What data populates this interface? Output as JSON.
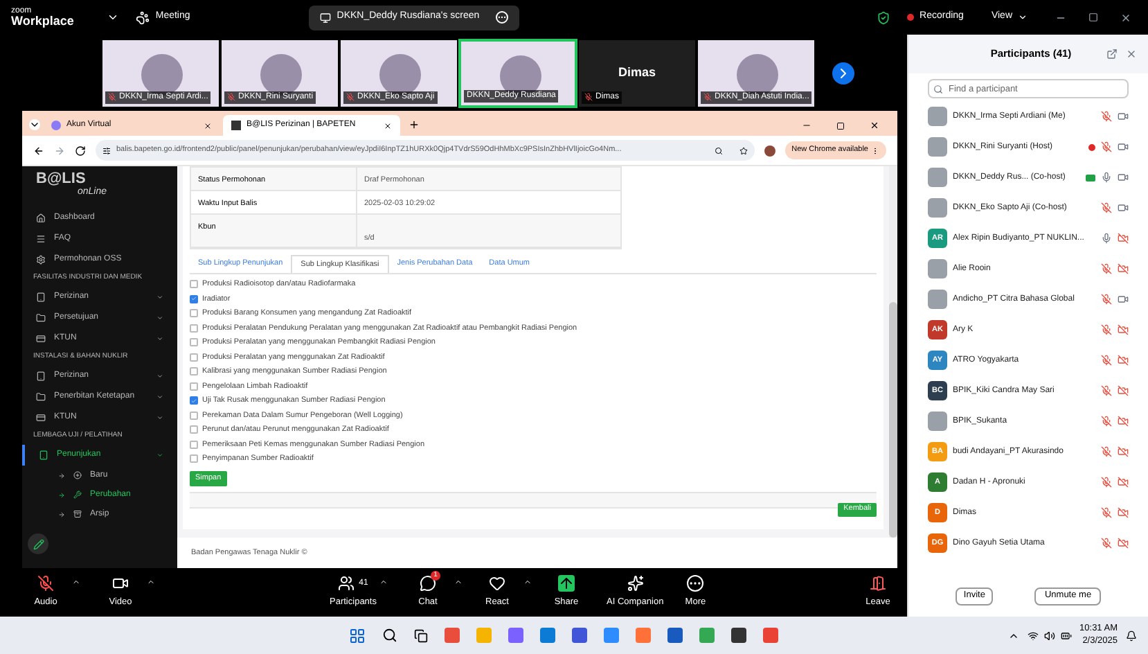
{
  "zoom_bar": {
    "brand_top": "zoom",
    "brand": "Workplace",
    "meeting": "Meeting",
    "share_pill": "DKKN_Deddy Rusdiana's screen",
    "recording": "Recording",
    "view": "View"
  },
  "video_tiles": [
    {
      "name": "DKKN_Irma Septi Ardi...",
      "muted": true,
      "speaking": false,
      "video": true
    },
    {
      "name": "DKKN_Rini Suryanti",
      "muted": true,
      "speaking": false,
      "video": true
    },
    {
      "name": "DKKN_Eko Sapto Aji",
      "muted": true,
      "speaking": false,
      "video": true
    },
    {
      "name": "DKKN_Deddy Rusdiana",
      "muted": false,
      "speaking": true,
      "video": true
    },
    {
      "name": "Dimas",
      "muted": true,
      "speaking": false,
      "video": false,
      "display_name": "Dimas"
    },
    {
      "name": "DKKN_Diah Astuti India...",
      "muted": true,
      "speaking": false,
      "video": true
    }
  ],
  "browser": {
    "tabs": [
      {
        "label": "Akun Virtual",
        "selected": false
      },
      {
        "label": "B@LIS Perizinan | BAPETEN",
        "selected": true
      }
    ],
    "url": "balis.bapeten.go.id/frontend2/public/panel/penunjukan/perubahan/view/eyJpdiI6InpTZ1hURXk0Qjp4TVdrS59OdHhMbXc9PSIsInZhbHVlIjoicGo4Nm...",
    "update_button": "New Chrome available"
  },
  "sidebar": {
    "logo": "B@LIS",
    "logo_sub": "onLine",
    "sections": [
      {
        "items": [
          {
            "label": "Dashboard",
            "expandable": false,
            "selected": false
          },
          {
            "label": "FAQ",
            "expandable": false,
            "selected": false
          },
          {
            "label": "Permohonan OSS",
            "expandable": false,
            "selected": false
          }
        ]
      },
      {
        "title": "FASILITAS INDUSTRI DAN MEDIK",
        "items": [
          {
            "label": "Perizinan",
            "expandable": true,
            "selected": false
          },
          {
            "label": "Persetujuan",
            "expandable": true,
            "selected": false
          },
          {
            "label": "KTUN",
            "expandable": true,
            "selected": false
          }
        ]
      },
      {
        "title": "INSTALASI & BAHAN NUKLIR",
        "items": [
          {
            "label": "Perizinan",
            "expandable": true,
            "selected": false
          },
          {
            "label": "Penerbitan Ketetapan",
            "expandable": true,
            "selected": false
          },
          {
            "label": "KTUN",
            "expandable": true,
            "selected": false
          }
        ]
      },
      {
        "title": "LEMBAGA UJI / PELATIHAN",
        "items": [
          {
            "label": "Penunjukan",
            "expandable": true,
            "selected": true,
            "children": [
              {
                "label": "Baru",
                "selected": false
              },
              {
                "label": "Perubahan",
                "selected": true
              },
              {
                "label": "Arsip",
                "selected": false
              }
            ]
          }
        ]
      }
    ]
  },
  "info_table": [
    {
      "label": "Status Permohonan",
      "value": "Draf Permohonan"
    },
    {
      "label": "Waktu Input Balis",
      "value": "2025-02-03 10:29:02"
    },
    {
      "label": "Kbun",
      "value": "s/d"
    }
  ],
  "tabs": [
    {
      "label": "Sub Lingkup Penunjukan",
      "selected": false
    },
    {
      "label": "Sub Lingkup Klasifikasi",
      "selected": true
    },
    {
      "label": "Jenis Perubahan Data",
      "selected": false
    },
    {
      "label": "Data Umum",
      "selected": false
    }
  ],
  "options": [
    {
      "label": "Produksi Radioisotop dan/atau Radiofarmaka",
      "checked": false
    },
    {
      "label": "Iradiator",
      "checked": true
    },
    {
      "label": "Produksi Barang Konsumen yang mengandung Zat Radioaktif",
      "checked": false
    },
    {
      "label": "Produksi Peralatan Pendukung Peralatan yang menggunakan Zat Radioaktif atau Pembangkit Radiasi Pengion",
      "checked": false
    },
    {
      "label": "Produksi Peralatan yang menggunakan Pembangkit Radiasi Pengion",
      "checked": false
    },
    {
      "label": "Produksi Peralatan yang menggunakan Zat Radioaktif",
      "checked": false
    },
    {
      "label": "Kalibrasi yang menggunakan Sumber Radiasi Pengion",
      "checked": false
    },
    {
      "label": "Pengelolaan Limbah Radioaktif",
      "checked": false
    },
    {
      "label": "Uji Tak Rusak menggunakan Sumber Radiasi Pengion",
      "checked": true
    },
    {
      "label": "Perekaman Data Dalam Sumur Pengeboran (Well Logging)",
      "checked": false
    },
    {
      "label": "Perunut dan/atau Perunut menggunakan Zat Radioaktif",
      "checked": false
    },
    {
      "label": "Pemeriksaan Peti Kemas menggunakan Sumber Radiasi Pengion",
      "checked": false
    },
    {
      "label": "Penyimpanan Sumber Radioaktif",
      "checked": false
    }
  ],
  "save_button": "Simpan",
  "back_button": "Kembali",
  "footer": "Badan Pengawas Tenaga Nuklir ©",
  "toolbar": [
    {
      "kind": "audio",
      "label": "Audio",
      "muted": true
    },
    {
      "kind": "video",
      "label": "Video"
    },
    {
      "kind": "participants",
      "label": "Participants",
      "count": "41"
    },
    {
      "kind": "chat",
      "label": "Chat",
      "badge": "1"
    },
    {
      "kind": "react",
      "label": "React"
    },
    {
      "kind": "share",
      "label": "Share"
    },
    {
      "kind": "ai",
      "label": "AI Companion"
    },
    {
      "kind": "more",
      "label": "More"
    },
    {
      "kind": "leave",
      "label": "Leave"
    }
  ],
  "participants": {
    "title": "Participants (41)",
    "search_placeholder": "Find a participant",
    "list": [
      {
        "name": "DKKN_Irma Septi Ardiani (Me)",
        "mic_muted": true,
        "video_off": false
      },
      {
        "name": "DKKN_Rini Suryanti (Host)",
        "recording": true,
        "mic_muted": true,
        "video_off": false
      },
      {
        "name": "DKKN_Deddy Rus... (Co-host)",
        "sharing": true,
        "mic_muted": false,
        "video_off": false
      },
      {
        "name": "DKKN_Eko Sapto Aji (Co-host)",
        "mic_muted": true,
        "video_off": false
      },
      {
        "name": "Alex Ripin Budiyanto_PT NUKLIN...",
        "initials": "AR",
        "color": "#1a9a7e",
        "mic_muted": false,
        "video_off": true
      },
      {
        "name": "Alie Rooin",
        "mic_muted": true,
        "video_off": true
      },
      {
        "name": "Andicho_PT Citra Bahasa Global",
        "mic_muted": true,
        "video_off": false
      },
      {
        "name": "Ary K",
        "initials": "AK",
        "color": "#c0392b",
        "mic_muted": true,
        "video_off": true
      },
      {
        "name": "ATRO Yogyakarta",
        "initials": "AY",
        "color": "#2e86c1",
        "mic_muted": true,
        "video_off": true
      },
      {
        "name": "BPIK_Kiki Candra May Sari",
        "initials": "BC",
        "color": "#2c3e50",
        "mic_muted": true,
        "video_off": true
      },
      {
        "name": "BPIK_Sukanta",
        "mic_muted": true,
        "video_off": true
      },
      {
        "name": "budi Andayani_PT Akurasindo",
        "initials": "BA",
        "color": "#f39c12",
        "mic_muted": true,
        "video_off": true
      },
      {
        "name": "Dadan H - Apronuki",
        "initials": "A",
        "color": "#2e7d32",
        "mic_muted": true,
        "video_off": true
      },
      {
        "name": "Dimas",
        "initials": "D",
        "color": "#e8650a",
        "mic_muted": true,
        "video_off": true
      },
      {
        "name": "Dino Gayuh Setia Utama",
        "initials": "DG",
        "color": "#e8650a",
        "mic_muted": true,
        "video_off": true
      }
    ],
    "invite": "Invite",
    "unmute": "Unmute me"
  },
  "taskbar": {
    "time": "10:31 AM",
    "date": "2/3/2025"
  }
}
